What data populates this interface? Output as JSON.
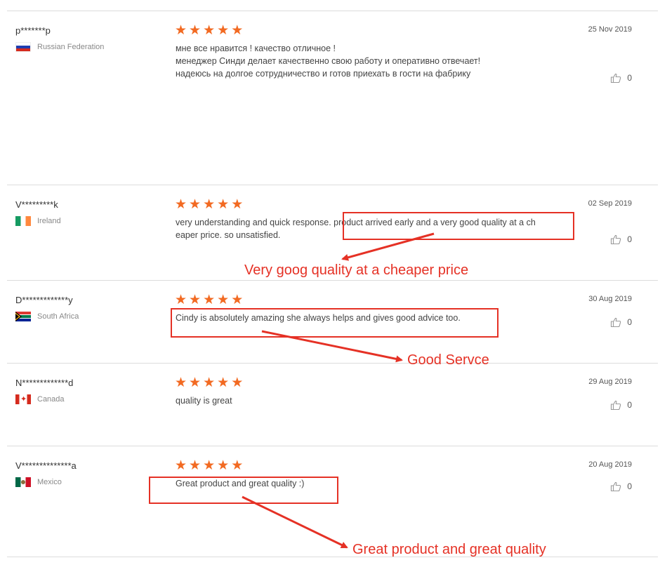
{
  "reviews": [
    {
      "user": "p*******p",
      "country": "Russian Federation",
      "flag": "ru",
      "rating": 5,
      "date": "25 Nov 2019",
      "text": "мне все нравится ! качество отличное !\nменеджер Синди делает качественно свою работу и оперативно отвечает!\nнадеюсь на долгое сотрудничество и готов приехать в гости на фабрику",
      "likes": "0"
    },
    {
      "user": "V*********k",
      "country": "Ireland",
      "flag": "ie",
      "rating": 5,
      "date": "02 Sep 2019",
      "text": "very understanding and quick response. product arrived early and a very good quality at a ch\neaper price. so unsatisfied.",
      "likes": "0"
    },
    {
      "user": "D*************y",
      "country": "South Africa",
      "flag": "za",
      "rating": 5,
      "date": "30 Aug 2019",
      "text": "Cindy is absolutely amazing she always helps and gives good advice too.",
      "likes": "0"
    },
    {
      "user": "N*************d",
      "country": "Canada",
      "flag": "ca",
      "rating": 5,
      "date": "29 Aug 2019",
      "text": "quality is great",
      "likes": "0"
    },
    {
      "user": "V**************a",
      "country": "Mexico",
      "flag": "mx",
      "rating": 5,
      "date": "20 Aug 2019",
      "text": "Great product and great quality :)",
      "likes": "0"
    }
  ],
  "annotations": {
    "a1": "Very goog quality at a cheaper price",
    "a2": "Good Servce",
    "a3": "Great product and great quality"
  },
  "colors": {
    "star": "#f26a22",
    "annotation": "#e53125"
  }
}
